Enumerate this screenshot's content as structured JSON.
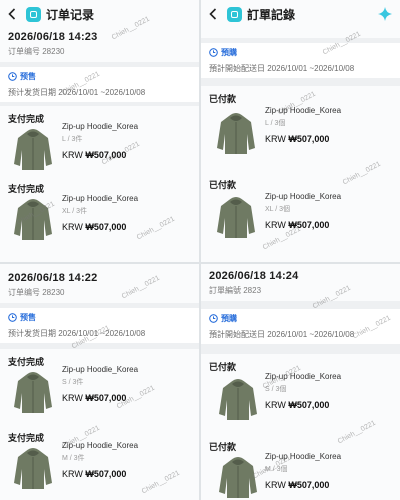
{
  "panels": [
    {
      "title": "订单记录",
      "order_time": "2026/06/18 14:23",
      "order_no": "订单编号 28230",
      "presale": "预售",
      "ship_date": "预计发货日期 2026/10/01 ~2026/10/08",
      "items": [
        {
          "status": "支付完成",
          "name": "Zip-up Hoodie_Korea",
          "variant": "L / 3件",
          "currency": "KRW",
          "price": "₩507,000"
        },
        {
          "status": "支付完成",
          "name": "Zip-up Hoodie_Korea",
          "variant": "XL / 3件",
          "currency": "KRW",
          "price": "₩507,000"
        }
      ]
    },
    {
      "title": "訂單記錄",
      "order_time": "",
      "order_no": "",
      "presale": "預購",
      "ship_date": "預計開始配送日 2026/10/01 ~2026/10/08",
      "items": [
        {
          "status": "已付款",
          "name": "Zip-up Hoodie_Korea",
          "variant": "L / 3個",
          "currency": "KRW",
          "price": "₩507,000"
        },
        {
          "status": "已付款",
          "name": "Zip-up Hoodie_Korea",
          "variant": "XL / 3個",
          "currency": "KRW",
          "price": "₩507,000"
        }
      ]
    },
    {
      "title": "",
      "order_time": "2026/06/18 14:22",
      "order_no": "订单编号 28230",
      "presale": "预售",
      "ship_date": "预计发货日期 2026/10/01 ~2026/10/08",
      "items": [
        {
          "status": "支付完成",
          "name": "Zip-up Hoodie_Korea",
          "variant": "S / 3件",
          "currency": "KRW",
          "price": "₩507,000"
        },
        {
          "status": "支付完成",
          "name": "Zip-up Hoodie_Korea",
          "variant": "M / 3件",
          "currency": "KRW",
          "price": "₩507,000"
        }
      ]
    },
    {
      "title": "",
      "order_time": "2026/06/18 14:24",
      "order_no": "訂單編號 2823",
      "presale": "預購",
      "ship_date": "預計開始配送日 2026/10/01 ~2026/10/08",
      "items": [
        {
          "status": "已付款",
          "name": "Zip-up Hoodie_Korea",
          "variant": "S / 3個",
          "currency": "KRW",
          "price": "₩507,000"
        },
        {
          "status": "已付款",
          "name": "Zip-up Hoodie_Korea",
          "variant": "M / 3個",
          "currency": "KRW",
          "price": "₩507,000"
        }
      ]
    }
  ],
  "watermark": "Chieh__0221",
  "icons": {
    "back": "chevron-left-icon",
    "logo": "app-logo-icon",
    "presale": "clock-icon",
    "sparkle": "sparkle-icon",
    "product": "hoodie-thumbnail"
  },
  "colors": {
    "accent": "#2ec4d6",
    "presale": "#2a6fdb",
    "hoodie": "#6f7a63"
  }
}
